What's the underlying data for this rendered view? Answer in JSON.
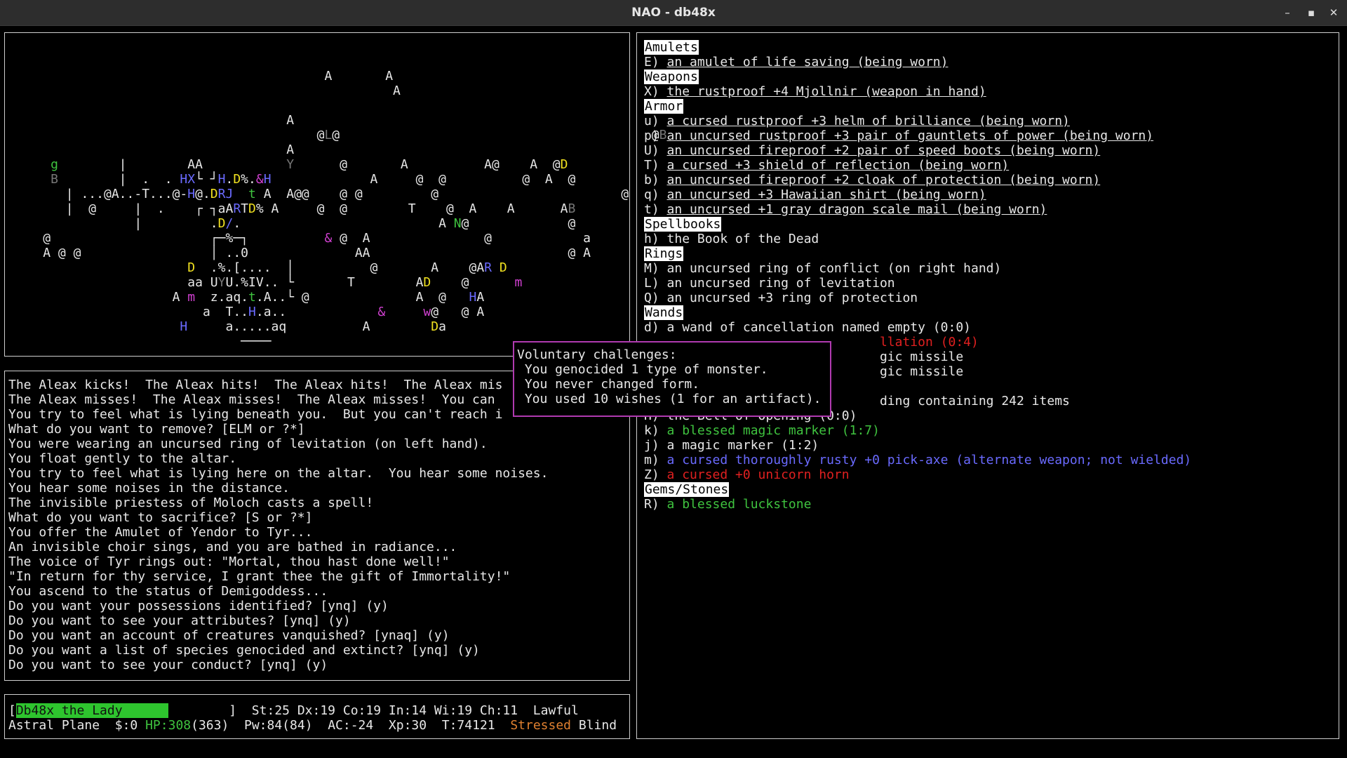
{
  "window": {
    "title": "NAO - db48x",
    "minimize": "–",
    "maximize": "▪",
    "close": "✕"
  },
  "map": {
    "rows": [
      "                                          A       A",
      "                                                   A",
      "",
      "                                     A",
      "                                         @L@                                         @B",
      "                                     A",
      "      g        |        AA           Y      @       A          A@    A  @D",
      "      B        |  .  . HX└ ┘H.D%.&H             A     @  @          @  A  @",
      "        | ...@A..-T...@-H@.DRJ  t A  A@@    @ @         @                        @",
      "        |  @     |  .    ┌ ┐aARTD% A     @  @        T    @  A    A      AB",
      "                 |         .D/.                          A N@             @",
      "     @                     ┌─%─┐          & @  A               @            a",
      "     A @ @                 │ ..0              AA                          @ A",
      "                        D  .%.[....  │          @       A    @AR D",
      "                        aa UYU.%IV.. └       T        AD    @      m",
      "                      A m  z.aq.t.A..└ @              A  @   HA",
      "                          a  T..H.a..            &     w@   @ A",
      "                       H     a.....aq          A        Da",
      "                               ────"
    ]
  },
  "inventory": {
    "categories": [
      {
        "name": "Amulets",
        "items": [
          {
            "text": "E) an amulet of life saving (being worn)",
            "ul": true,
            "color": "#e8e8e8"
          }
        ]
      },
      {
        "name": "Weapons",
        "items": [
          {
            "text": "X) the rustproof +4 Mjollnir (weapon in hand)",
            "ul": true,
            "color": "#e8e8e8"
          }
        ]
      },
      {
        "name": "Armor",
        "items": [
          {
            "text": "u) a cursed rustproof +3 helm of brilliance (being worn)",
            "ul": true,
            "color": "#e8e8e8"
          },
          {
            "text": "p) an uncursed rustproof +3 pair of gauntlets of power (being worn)",
            "ul": true,
            "color": "#e8e8e8"
          },
          {
            "text": "U) an uncursed fireproof +2 pair of speed boots (being worn)",
            "ul": true,
            "color": "#e8e8e8"
          },
          {
            "text": "T) a cursed +3 shield of reflection (being worn)",
            "ul": true,
            "color": "#e8e8e8"
          },
          {
            "text": "b) an uncursed fireproof +2 cloak of protection (being worn)",
            "ul": true,
            "color": "#e8e8e8"
          },
          {
            "text": "q) an uncursed +3 Hawaiian shirt (being worn)",
            "ul": true,
            "color": "#e8e8e8"
          },
          {
            "text": "t) an uncursed +1 gray dragon scale mail (being worn)",
            "ul": true,
            "color": "#e8e8e8"
          }
        ]
      },
      {
        "name": "Spellbooks",
        "items": [
          {
            "text": "h) the Book of the Dead",
            "ul": false,
            "color": "#e8e8e8"
          }
        ]
      },
      {
        "name": "Rings",
        "items": [
          {
            "text": "M) an uncursed ring of conflict (on right hand)",
            "ul": false,
            "color": "#e8e8e8"
          },
          {
            "text": "L) an uncursed ring of levitation",
            "ul": false,
            "color": "#e8e8e8"
          },
          {
            "text": "Q) an uncursed +3 ring of protection",
            "ul": false,
            "color": "#e8e8e8"
          }
        ]
      },
      {
        "name": "Wands",
        "items": [
          {
            "text": "d) a wand of cancellation named empty (0:0)",
            "ul": false,
            "color": "#e8e8e8"
          },
          {
            "text": "                               llation (0:4)",
            "ul": false,
            "color": "#e02020"
          },
          {
            "text": "                               gic missile",
            "ul": false,
            "color": "#e8e8e8"
          },
          {
            "text": "                               gic missile",
            "ul": false,
            "color": "#e8e8e8"
          },
          {
            "text": "",
            "ul": false,
            "color": "#e8e8e8"
          },
          {
            "text": "                               ding containing 242 items",
            "ul": false,
            "color": "#e8e8e8"
          },
          {
            "text": "H) the Bell of Opening (0:0)",
            "ul": false,
            "color": "#e8e8e8"
          },
          {
            "text": "k) a blessed magic marker (1:7)",
            "ul": false,
            "color": "#3fc33f"
          },
          {
            "text": "j) a magic marker (1:2)",
            "ul": false,
            "color": "#e8e8e8"
          },
          {
            "text": "m) a cursed thoroughly rusty +0 pick-axe (alternate weapon; not wielded)",
            "ul": false,
            "color": "#6a6aff"
          },
          {
            "text": "Z) a cursed +0 unicorn horn",
            "ul": false,
            "color": "#e02020"
          }
        ]
      },
      {
        "name": "Gems/Stones",
        "items": [
          {
            "text": "R) a blessed luckstone",
            "ul": false,
            "color": "#3fc33f"
          }
        ]
      }
    ]
  },
  "messages": [
    "The Aleax kicks!  The Aleax hits!  The Aleax hits!  The Aleax mis",
    "The Aleax misses!  The Aleax misses!  The Aleax misses!  You can",
    "You try to feel what is lying beneath you.  But you can't reach i",
    "What do you want to remove? [ELM or ?*]",
    "You were wearing an uncursed ring of levitation (on left hand).",
    "You float gently to the altar.",
    "You try to feel what is lying here on the altar.  You hear some noises.",
    "You hear some noises in the distance.",
    "The invisible priestess of Moloch casts a spell!",
    "What do you want to sacrifice? [S or ?*]",
    "You offer the Amulet of Yendor to Tyr...",
    "An invisible choir sings, and you are bathed in radiance...",
    "The voice of Tyr rings out: \"Mortal, thou hast done well!\"",
    "\"In return for thy service, I grant thee the gift of Immortality!\"",
    "You ascend to the status of Demigoddess...",
    "Do you want your possessions identified? [ynq] (y)",
    "Do you want to see your attributes? [ynq] (y)",
    "Do you want an account of creatures vanquished? [ynaq] (y)",
    "Do you want a list of species genocided and extinct? [ynq] (y)",
    "Do you want to see your conduct? [ynq] (y)"
  ],
  "popup": {
    "title": "Voluntary challenges:",
    "lines": [
      " You genocided 1 type of monster.",
      " You never changed form.",
      " You used 10 wishes (1 for an artifact)."
    ]
  },
  "status": {
    "name": "Db48x the Lady",
    "stats": "]  St:25 Dx:19 Co:19 In:14 Wi:19 Ch:11  Lawful",
    "level": "Astral Plane",
    "gold": "$:0",
    "hp": "HP:308",
    "hpmax": "(363)",
    "rest": "Pw:84(84)  AC:-24  Xp:30  T:74121",
    "stressed": "Stressed",
    "blind": "Blind",
    "hp_fraction": 0.848
  }
}
